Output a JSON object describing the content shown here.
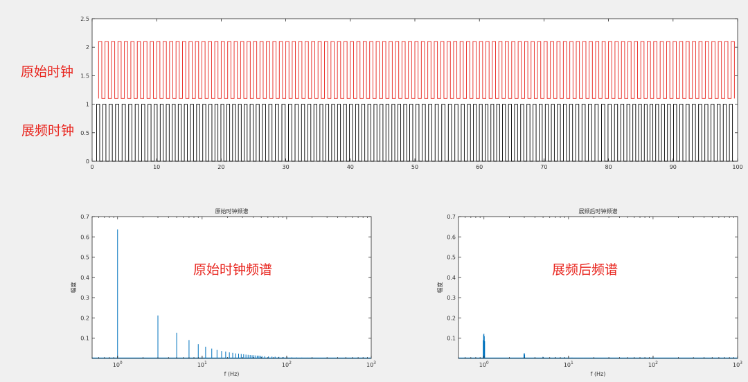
{
  "colors": {
    "background": "#f0f0f0",
    "plot_bg": "#ffffff",
    "axis": "#262626",
    "original_clock": "#e8231c",
    "spread_clock": "#000000",
    "spectrum": "#0072bd",
    "annotation": "#e8231c"
  },
  "annotations": {
    "original_clock": "原始时钟",
    "spread_clock": "展频时钟",
    "original_spectrum": "原始时钟频谱",
    "spread_spectrum": "展频后频谱"
  },
  "chart_data": [
    {
      "id": "time",
      "type": "line",
      "title": "",
      "xlabel": "",
      "ylabel": "",
      "xlim": [
        0,
        100
      ],
      "ylim": [
        0,
        2.5
      ],
      "xticks": [
        0,
        10,
        20,
        30,
        40,
        50,
        60,
        70,
        80,
        90,
        100
      ],
      "yticks": [
        0,
        0.5,
        1,
        1.5,
        2,
        2.5
      ],
      "ytick_labels": [
        "0",
        "0.5",
        "1",
        "1.5",
        "2",
        "2.5"
      ],
      "series": [
        {
          "id": "original",
          "color": "#e8231c",
          "low": 1.1,
          "high": 2.1,
          "start": 1.0,
          "end": 99.5,
          "period": 1.0,
          "duty": 0.5
        },
        {
          "id": "spread",
          "color": "#000000",
          "low": 0,
          "high": 1,
          "start": 0.7,
          "end": 99.5,
          "period": 0.95,
          "duty": 0.5,
          "spread": 0.08
        }
      ]
    },
    {
      "id": "spectrum_original",
      "type": "bar",
      "title": "原始时钟频谱",
      "xlabel": "f (Hz)",
      "ylabel": "幅度",
      "xscale": "log",
      "xlim": [
        0.5,
        1000
      ],
      "ylim": [
        0,
        0.7
      ],
      "xticks": [
        1,
        10,
        100,
        1000
      ],
      "xtick_labels": [
        "10^0",
        "10^1",
        "10^2",
        "10^3"
      ],
      "yticks": [
        0.1,
        0.2,
        0.3,
        0.4,
        0.5,
        0.6,
        0.7
      ],
      "x": [
        1,
        3,
        5,
        7,
        9,
        11,
        13,
        15,
        17,
        19,
        21,
        23,
        25,
        27,
        29,
        31,
        33,
        35,
        37,
        39,
        41,
        43,
        45,
        47,
        49,
        51,
        55,
        61,
        67,
        73,
        81,
        91,
        101,
        115,
        131,
        151,
        175,
        205,
        245,
        299
      ],
      "values": [
        0.637,
        0.212,
        0.127,
        0.091,
        0.071,
        0.058,
        0.049,
        0.042,
        0.037,
        0.034,
        0.03,
        0.028,
        0.025,
        0.024,
        0.022,
        0.021,
        0.019,
        0.018,
        0.017,
        0.016,
        0.016,
        0.015,
        0.014,
        0.014,
        0.013,
        0.012,
        0.011,
        0.01,
        0.0095,
        0.0087,
        0.0079,
        0.007,
        0.0063,
        0.0055,
        0.0049,
        0.0042,
        0.0036,
        0.0031,
        0.0026,
        0.0021
      ]
    },
    {
      "id": "spectrum_spread",
      "type": "bar",
      "title": "展频后时钟频谱",
      "xlabel": "f (Hz)",
      "ylabel": "幅度",
      "xscale": "log",
      "xlim": [
        0.5,
        1000
      ],
      "ylim": [
        0,
        0.7
      ],
      "xticks": [
        1,
        10,
        100,
        1000
      ],
      "xtick_labels": [
        "10^0",
        "10^1",
        "10^2",
        "10^3"
      ],
      "yticks": [
        0.1,
        0.2,
        0.3,
        0.4,
        0.5,
        0.6,
        0.7
      ],
      "x": [
        0.98,
        0.99,
        1.0,
        1.01,
        1.02,
        2.97,
        3.0,
        3.03,
        4.98,
        5.02,
        7.0,
        9.0,
        11.0,
        13.0,
        15.0,
        17.0,
        19.0,
        21.0,
        25.0,
        31.0,
        41.0,
        51.0,
        71.0,
        101.0,
        151.0,
        201.0,
        301.0
      ],
      "values": [
        0.09,
        0.118,
        0.122,
        0.11,
        0.085,
        0.022,
        0.027,
        0.02,
        0.008,
        0.007,
        0.006,
        0.004,
        0.004,
        0.003,
        0.003,
        0.002,
        0.002,
        0.002,
        0.002,
        0.0015,
        0.0015,
        0.0012,
        0.0012,
        0.001,
        0.001,
        0.0008,
        0.0008
      ]
    }
  ]
}
